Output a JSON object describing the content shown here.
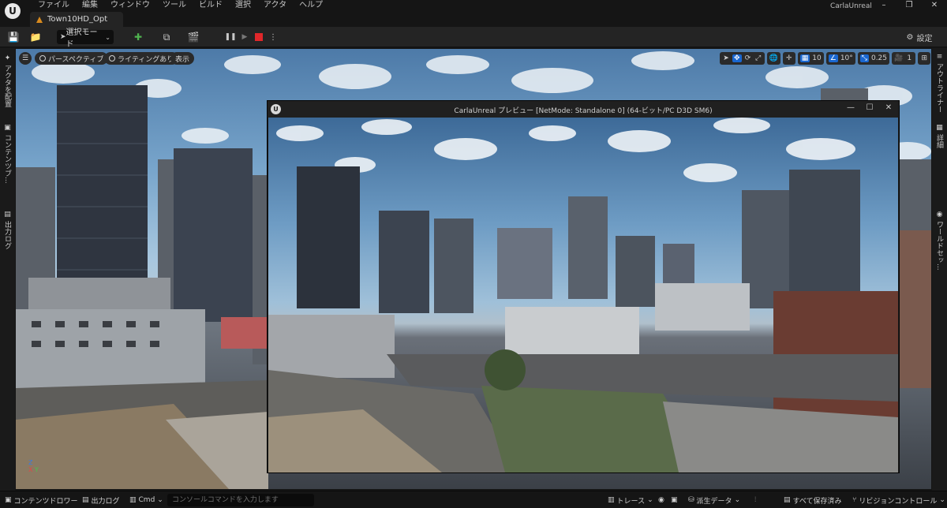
{
  "app": {
    "logo": "U",
    "title": "CarlaUnreal",
    "menu": [
      "ファイル",
      "編集",
      "ウィンドウ",
      "ツール",
      "ビルド",
      "選択",
      "アクタ",
      "ヘルプ"
    ],
    "document_tab": "Town10HD_Opt",
    "window_controls": {
      "minimize": "–",
      "restore": "❐",
      "close": "✕"
    }
  },
  "toolbar": {
    "save_icon": "💾",
    "browse_icon": "📁",
    "mode_label": "選択モード",
    "add_icon": "✚",
    "blueprint_icon": "⧉",
    "cinematics_icon": "🎬",
    "pause_icon": "❚❚",
    "step_icon": "▶",
    "stop_icon": "■",
    "more_icon": "⋮",
    "settings_label": "設定",
    "settings_icon": "⚙"
  },
  "left_sidebar": {
    "tabs": [
      {
        "label": "アクタを配置",
        "icon": "✦"
      },
      {
        "label": "コンテンツブ...",
        "icon": "▣"
      },
      {
        "label": "出力ログ",
        "icon": "▤"
      }
    ]
  },
  "right_sidebar": {
    "tabs": [
      {
        "label": "アウトライナー",
        "icon": "≡"
      },
      {
        "label": "詳細",
        "icon": "▦"
      },
      {
        "label": "ワールドセッ...",
        "icon": "◉"
      }
    ]
  },
  "viewport": {
    "menu_icon": "☰",
    "perspective": "パースペクティブ",
    "lighting": "ライティングあり",
    "show": "表示",
    "grid_snap": "10",
    "rotation_snap": "10°",
    "scale_snap": "0.25",
    "camera_speed": "1",
    "axis_z": "Z",
    "axis_x": "X",
    "axis_y": "Y"
  },
  "preview": {
    "logo": "U",
    "title": "CarlaUnreal プレビュー [NetMode: Standalone 0]  (64-ビット/PC D3D SM6)",
    "minimize": "—",
    "maximize": "☐",
    "close": "✕"
  },
  "statusbar": {
    "content_drawer": "コンテンツドロワー",
    "output_log": "出力ログ",
    "cmd": "Cmd",
    "console_placeholder": "コンソールコマンドを入力します",
    "trace": "トレース",
    "derived_data": "派生データ",
    "save_all": "すべて保存済み",
    "revision_control": "リビジョンコントロール"
  }
}
